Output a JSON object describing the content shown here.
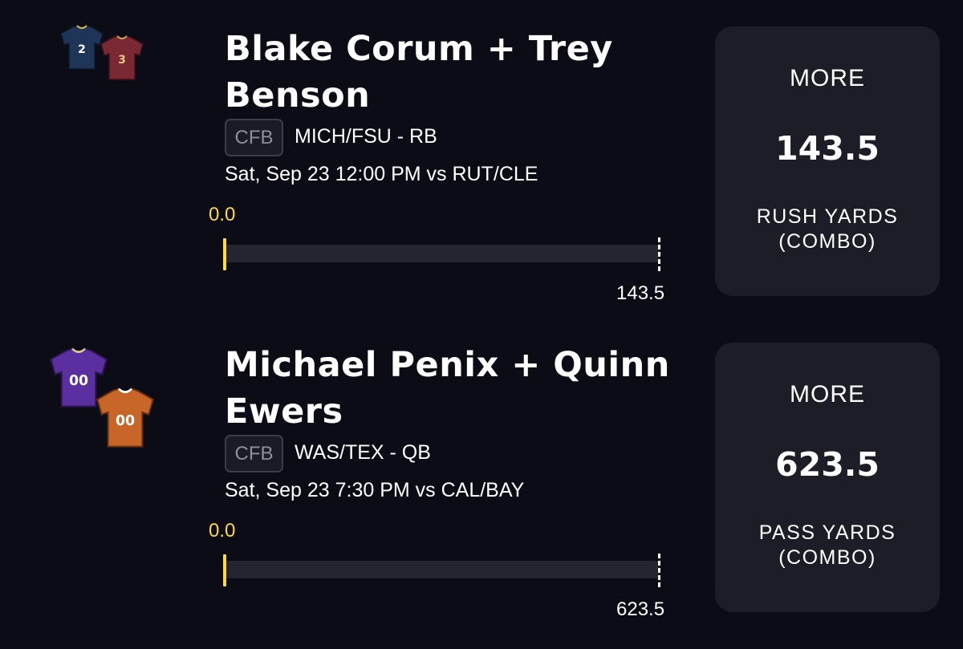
{
  "picks": [
    {
      "player_name": "Blake Corum + Trey Benson",
      "league": "CFB",
      "matchup": "MICH/FSU - RB",
      "game_time": "Sat, Sep 23 12:00 PM  vs RUT/CLE",
      "current_value": "0.0",
      "progress_fraction": 0,
      "target_value": "143.5",
      "direction": "MORE",
      "line": "143.5",
      "stat_line1": "RUSH YARDS",
      "stat_line2": "(COMBO)",
      "jerseys": [
        {
          "number": "2",
          "color": "#1f3557"
        },
        {
          "number": "3",
          "color": "#7a2834"
        }
      ]
    },
    {
      "player_name": "Michael Penix + Quinn Ewers",
      "league": "CFB",
      "matchup": "WAS/TEX - QB",
      "game_time": "Sat, Sep 23 7:30 PM  vs CAL/BAY",
      "current_value": "0.0",
      "progress_fraction": 0,
      "target_value": "623.5",
      "direction": "MORE",
      "line": "623.5",
      "stat_line1": "PASS YARDS",
      "stat_line2": "(COMBO)",
      "jerseys": [
        {
          "number": "00",
          "color": "#5b2fa0"
        },
        {
          "number": "00",
          "color": "#c8662a"
        }
      ]
    }
  ],
  "colors": {
    "background": "#0b0c16",
    "card": "#1c1d27",
    "accent_yellow": "#ffd93d",
    "track": "#23252f"
  }
}
